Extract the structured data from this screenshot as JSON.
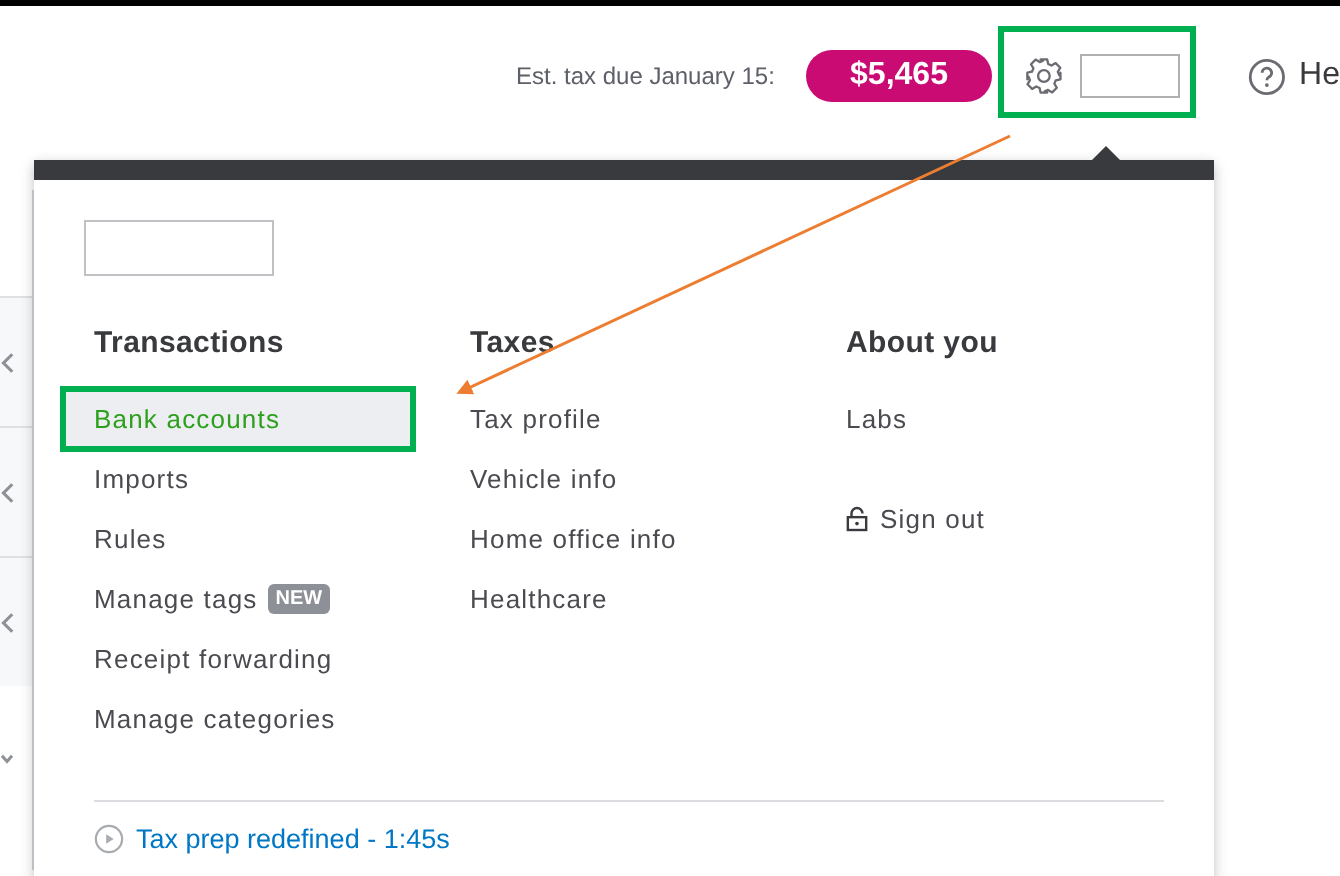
{
  "top_bar": {
    "tax_label": "Est. tax due January 15:",
    "tax_amount": "$5,465",
    "help_label": "He"
  },
  "menu": {
    "columns": [
      {
        "heading": "Transactions",
        "items": [
          {
            "kind": "link",
            "label": "Bank accounts",
            "selected": true
          },
          {
            "kind": "link",
            "label": "Imports",
            "selected": false
          },
          {
            "kind": "link",
            "label": "Rules",
            "selected": false
          },
          {
            "kind": "link",
            "label": "Manage tags",
            "badge": "NEW",
            "selected": false
          },
          {
            "kind": "link",
            "label": "Receipt forwarding",
            "selected": false
          },
          {
            "kind": "link",
            "label": "Manage categories",
            "selected": false
          }
        ]
      },
      {
        "heading": "Taxes",
        "items": [
          {
            "kind": "link",
            "label": "Tax profile",
            "selected": false
          },
          {
            "kind": "link",
            "label": "Vehicle info",
            "selected": false
          },
          {
            "kind": "link",
            "label": "Home office info",
            "selected": false
          },
          {
            "kind": "link",
            "label": "Healthcare",
            "selected": false
          }
        ]
      },
      {
        "heading": "About you",
        "items": [
          {
            "kind": "link",
            "label": "Labs",
            "selected": false
          },
          {
            "kind": "signout",
            "label": "Sign out",
            "selected": false
          }
        ]
      }
    ],
    "footer_link": "Tax prep redefined - 1:45s"
  }
}
